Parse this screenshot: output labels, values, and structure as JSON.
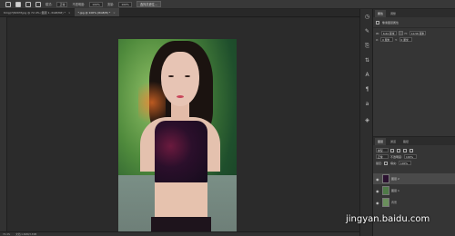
{
  "options_bar": {
    "mode_label": "模式:",
    "mode_value": "正常",
    "opacity_label": "不透明度:",
    "opacity_value": "100%",
    "flow_label": "流量:",
    "flow_value": "100%",
    "select_subject_button": "选择并遮住..."
  },
  "document_tabs": [
    {
      "label": "timg(7)8203f.jpg @ 72.4% (图层 1, RGB/8#) *",
      "active": false
    },
    {
      "label": "*.jpg @ 100% (RGB/8) *",
      "active": true
    }
  ],
  "status_bar": {
    "zoom": "72.4%",
    "doc_info": "文档:1.69M/3.39M"
  },
  "properties_panel": {
    "tabs": [
      "属性",
      "调整"
    ],
    "title": "像素图层属性",
    "w_label": "W:",
    "w_value": "6.64 厘米",
    "h_label": "H:",
    "h_value": "10.58 厘米",
    "x_label": "X:",
    "x_value": "0 厘米",
    "y_label": "Y:",
    "y_value": "0 厘米"
  },
  "layers_panel": {
    "tabs": [
      "图层",
      "通道",
      "路径"
    ],
    "kind_label": "类型",
    "blend_mode": "正常",
    "opacity_label": "不透明度:",
    "opacity_value": "100%",
    "lock_label": "锁定:",
    "fill_label": "填充:",
    "fill_value": "100%",
    "layers": [
      {
        "name": "图层 2",
        "selected": true
      },
      {
        "name": "图层 1",
        "selected": false
      },
      {
        "name": "背景",
        "selected": false
      }
    ]
  },
  "watermark": "jingyan.baidu.com"
}
